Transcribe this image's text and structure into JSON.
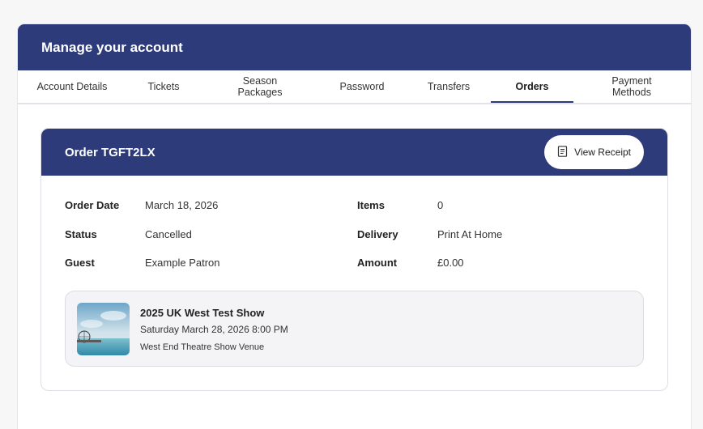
{
  "page": {
    "title": "Manage your account"
  },
  "tabs": [
    {
      "label": "Account Details"
    },
    {
      "label": "Tickets"
    },
    {
      "label": "Season Packages"
    },
    {
      "label": "Password"
    },
    {
      "label": "Transfers"
    },
    {
      "label": "Orders",
      "active": true
    },
    {
      "label": "Payment Methods"
    }
  ],
  "order": {
    "title": "Order TGFT2LX",
    "receipt_button": "View Receipt",
    "receipt_icon": "receipt-icon",
    "fields": {
      "order_date_label": "Order Date",
      "order_date": "March 18, 2026",
      "status_label": "Status",
      "status": "Cancelled",
      "guest_label": "Guest",
      "guest": "Example Patron",
      "items_label": "Items",
      "items": "0",
      "delivery_label": "Delivery",
      "delivery": "Print At Home",
      "amount_label": "Amount",
      "amount": "£0.00"
    },
    "event": {
      "name": "2025 UK West Test Show",
      "datetime": "Saturday March 28, 2026 8:00 PM",
      "venue": "West End Theatre Show Venue"
    }
  },
  "colors": {
    "brand": "#2e3b7a",
    "background": "#f7f7f8"
  }
}
